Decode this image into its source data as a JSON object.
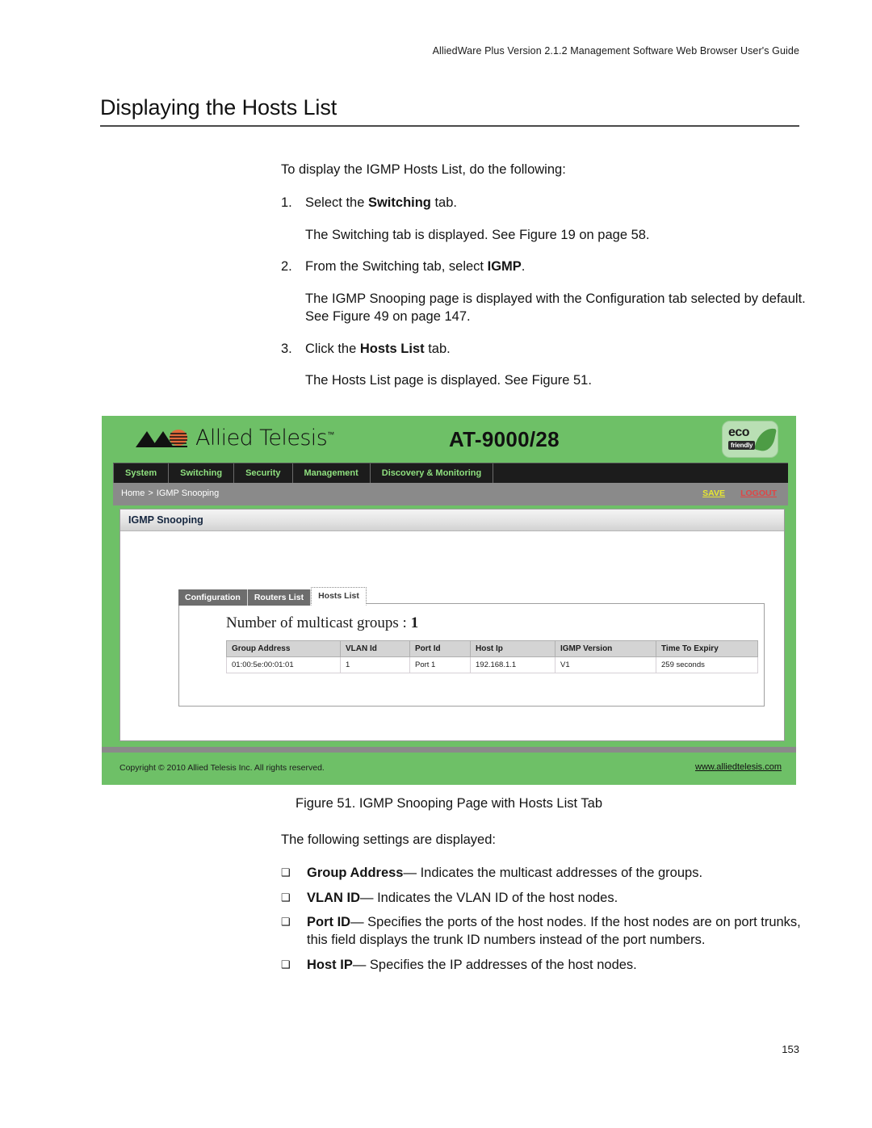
{
  "document": {
    "running_header": "AlliedWare Plus Version 2.1.2 Management Software Web Browser User's Guide",
    "title": "Displaying the Hosts List",
    "page_number": "153",
    "intro": "To display the IGMP Hosts List, do the following:",
    "steps": [
      {
        "number": "1.",
        "lead": "Select the ",
        "bold": "Switching",
        "tail": " tab.",
        "result": "The Switching tab is displayed. See Figure 19 on page 58."
      },
      {
        "number": "2.",
        "lead": "From the Switching tab, select ",
        "bold": "IGMP",
        "tail": ".",
        "result": "The IGMP Snooping page is displayed with the Configuration tab selected by default. See Figure 49 on page 147."
      },
      {
        "number": "3.",
        "lead": "Click the ",
        "bold": "Hosts List",
        "tail": " tab.",
        "result": "The Hosts List page is displayed. See Figure 51."
      }
    ],
    "figure_caption": "Figure 51. IGMP Snooping Page with Hosts List Tab",
    "settings_intro": "The following settings are displayed:",
    "bullets": [
      {
        "term": "Group Address",
        "desc": "— Indicates the multicast addresses of the groups."
      },
      {
        "term": "VLAN ID",
        "desc": "— Indicates the VLAN ID of the host nodes."
      },
      {
        "term": "Port ID",
        "desc": "— Specifies the ports of the host nodes. If the host nodes are on port trunks, this field displays the trunk ID numbers instead of the port numbers."
      },
      {
        "term": "Host IP",
        "desc": "— Specifies the IP addresses of the host nodes."
      }
    ],
    "bullet_glyph": "❑"
  },
  "device_ui": {
    "brand": "Allied Telesis",
    "brand_tm": "™",
    "model": "AT-9000/28",
    "eco_badge": {
      "main": "eco",
      "sub": "friendly"
    },
    "nav_tabs": [
      "System",
      "Switching",
      "Security",
      "Management",
      "Discovery & Monitoring"
    ],
    "breadcrumb": {
      "home": "Home",
      "separator": ">",
      "current": "IGMP Snooping"
    },
    "save_label": "SAVE",
    "logout_label": "LOGOUT",
    "panel_title": "IGMP Snooping",
    "sub_tabs": [
      {
        "label": "Configuration",
        "active": false
      },
      {
        "label": "Routers List",
        "active": false
      },
      {
        "label": "Hosts List",
        "active": true
      }
    ],
    "multicast_groups_label": "Number of multicast groups :",
    "multicast_groups_value": "1",
    "table": {
      "columns": [
        "Group Address",
        "VLAN Id",
        "Port Id",
        "Host Ip",
        "IGMP Version",
        "Time To Expiry"
      ],
      "rows": [
        [
          "01:00:5e:00:01:01",
          "1",
          "Port 1",
          "192.168.1.1",
          "V1",
          "259 seconds"
        ]
      ]
    },
    "footer_copyright": "Copyright © 2010 Allied Telesis Inc. All rights reserved.",
    "footer_link": "www.alliedtelesis.com",
    "colors": {
      "brand_green": "#6ec067",
      "nav_bar": "#1c1c1c",
      "nav_text": "#8fe07f",
      "breadcrumb_bar": "#8a8a8a",
      "save": "#e8e830",
      "logout": "#e04545",
      "table_header": "#d4d4d4"
    }
  }
}
